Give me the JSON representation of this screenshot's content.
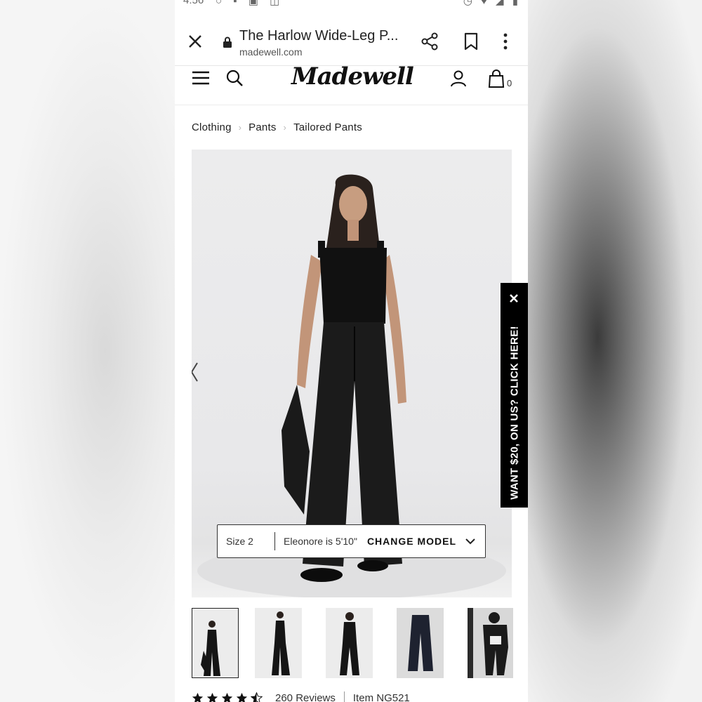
{
  "status_bar": {
    "time": "4:56"
  },
  "browser": {
    "page_title": "The Harlow Wide-Leg P...",
    "domain": "madewell.com",
    "icons": [
      "close-icon",
      "lock-icon",
      "share-icon",
      "bookmark-icon",
      "more-vert-icon"
    ]
  },
  "site_header": {
    "logo_text": "Madewell",
    "bag_count": "0",
    "icons": [
      "menu-icon",
      "search-icon",
      "account-icon",
      "bag-icon"
    ]
  },
  "breadcrumb": [
    {
      "label": "Clothing"
    },
    {
      "label": "Pants"
    },
    {
      "label": "Tailored Pants"
    }
  ],
  "model_info": {
    "size": "Size 2",
    "model": "Eleonore is 5'10\"",
    "change_label": "CHANGE MODEL"
  },
  "promo_tab": {
    "text": "WANT $20, ON US? CLICK HERE!"
  },
  "thumbnails": [
    {
      "label": "front"
    },
    {
      "label": "side"
    },
    {
      "label": "back"
    },
    {
      "label": "flat-lay"
    },
    {
      "label": "outfit"
    }
  ],
  "reviews": {
    "rating": 4.5,
    "count_label": "260 Reviews",
    "item_label": "Item NG521"
  },
  "colors": {
    "promo_bg": "#000000",
    "hero_bg": "#ececed"
  }
}
